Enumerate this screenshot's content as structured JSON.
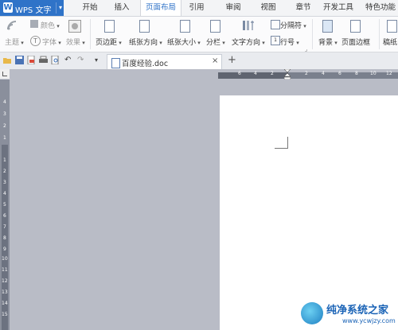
{
  "app": {
    "title": "WPS 文字"
  },
  "menu": {
    "tabs": [
      {
        "label": "开始"
      },
      {
        "label": "插入"
      },
      {
        "label": "页面布局"
      },
      {
        "label": "引用"
      },
      {
        "label": "审阅"
      },
      {
        "label": "视图"
      },
      {
        "label": "章节"
      },
      {
        "label": "开发工具"
      },
      {
        "label": "特色功能"
      }
    ],
    "active_index": 2
  },
  "ribbon": {
    "theme_label": "主题",
    "color_label": "颜色",
    "font_label": "字体",
    "effect_label": "效果",
    "margins_label": "页边距",
    "orientation_label": "纸张方向",
    "size_label": "纸张大小",
    "columns_label": "分栏",
    "text_direction_label": "文字方向",
    "separator_label": "分隔符",
    "line_number_label": "行号",
    "background_label": "背景",
    "page_border_label": "页面边框",
    "draft_label": "稿纸"
  },
  "document_tab": {
    "label": "百度经验.doc"
  },
  "ruler": {
    "horizontal_marks": [
      "6",
      "4",
      "2",
      "2",
      "4",
      "6",
      "8",
      "10",
      "12"
    ],
    "vertical_marks": [
      "4",
      "3",
      "2",
      "1",
      "1",
      "2",
      "3",
      "4",
      "5",
      "6",
      "7",
      "8",
      "9",
      "10",
      "11",
      "12",
      "13",
      "14",
      "15"
    ]
  },
  "watermark": {
    "title": "纯净系统之家",
    "url": "www.ycwjzy.com"
  },
  "colors": {
    "accent": "#2f73c8",
    "workspace": "#b9bcc6",
    "page": "#ffffff"
  }
}
